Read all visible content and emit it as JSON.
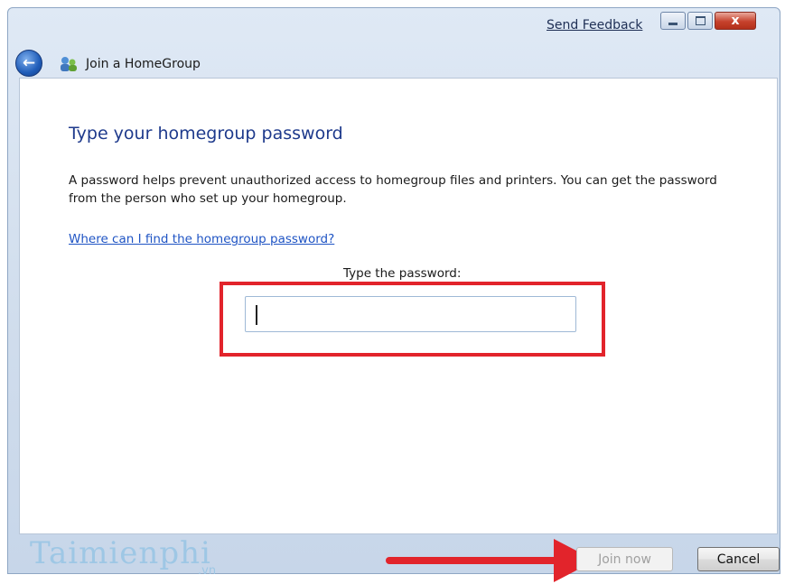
{
  "titlebar": {
    "feedback_link": "Send Feedback",
    "minimize_icon": "minimize-icon",
    "maximize_icon": "maximize-icon",
    "close_glyph": "x"
  },
  "navbar": {
    "back_icon": "back-arrow-icon",
    "app_icon": "homegroup-icon",
    "title": "Join a HomeGroup"
  },
  "main": {
    "heading": "Type your homegroup password",
    "description": "A password helps prevent unauthorized access to homegroup files and printers.  You can get the password from the person who set up your homegroup.",
    "help_link": "Where can I find the homegroup password?",
    "password_label": "Type the password:",
    "password_value": ""
  },
  "footer": {
    "join_label": "Join now",
    "join_enabled": false,
    "cancel_label": "Cancel"
  },
  "watermark": {
    "brand": "Taimienphi",
    "suffix": ".vn"
  },
  "colors": {
    "heading": "#1e3a8c",
    "link": "#1f54c4",
    "highlight": "#e2242b",
    "close_button": "#c6412c"
  }
}
